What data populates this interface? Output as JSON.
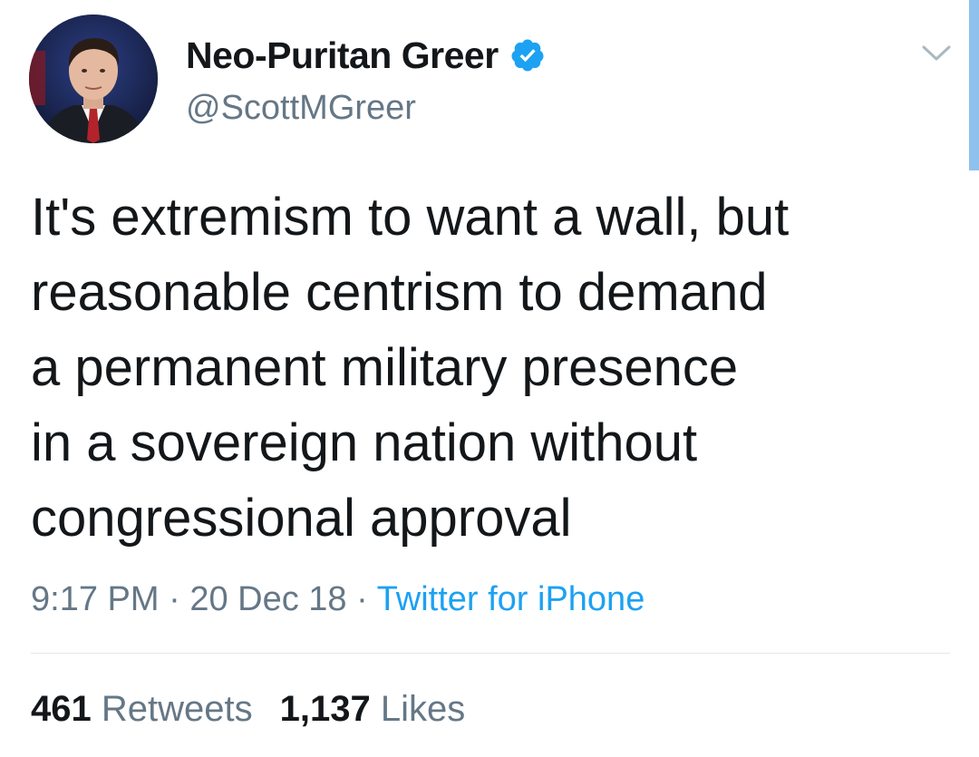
{
  "author": {
    "display_name": "Neo-Puritan Greer",
    "handle": "@ScottMGreer",
    "verified": true,
    "avatar_icon": "profile-photo"
  },
  "tweet": {
    "text": "It's extremism to want a wall, but\nreasonable centrism to demand\na permanent military presence\nin a sovereign nation without\ncongressional approval"
  },
  "meta": {
    "time": "9:17 PM",
    "separator": " · ",
    "date": "20 Dec 18",
    "source": "Twitter for iPhone"
  },
  "stats": {
    "retweets_count": "461",
    "retweets_label": "Retweets",
    "likes_count": "1,137",
    "likes_label": "Likes"
  },
  "colors": {
    "text": "#14171a",
    "secondary": "#657786",
    "link": "#1da1f2",
    "verified": "#1da1f2",
    "divider": "#e1e8ed"
  }
}
